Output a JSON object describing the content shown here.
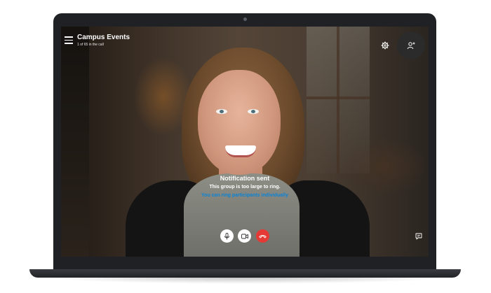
{
  "call": {
    "title": "Campus Events",
    "subtitle": "1 of 65 in the call"
  },
  "notification": {
    "title": "Notification sent",
    "message": "This group is too large to ring.",
    "link": "You can ring participants individually"
  },
  "icons": {
    "menu": "hamburger-menu-icon",
    "settings": "gear-icon",
    "add_participant": "add-person-icon",
    "mic": "microphone-icon",
    "video": "video-camera-icon",
    "end_call": "phone-hangup-icon",
    "chat": "chat-bubble-icon"
  },
  "colors": {
    "link": "#0a84d6",
    "end_call": "#e53935"
  }
}
